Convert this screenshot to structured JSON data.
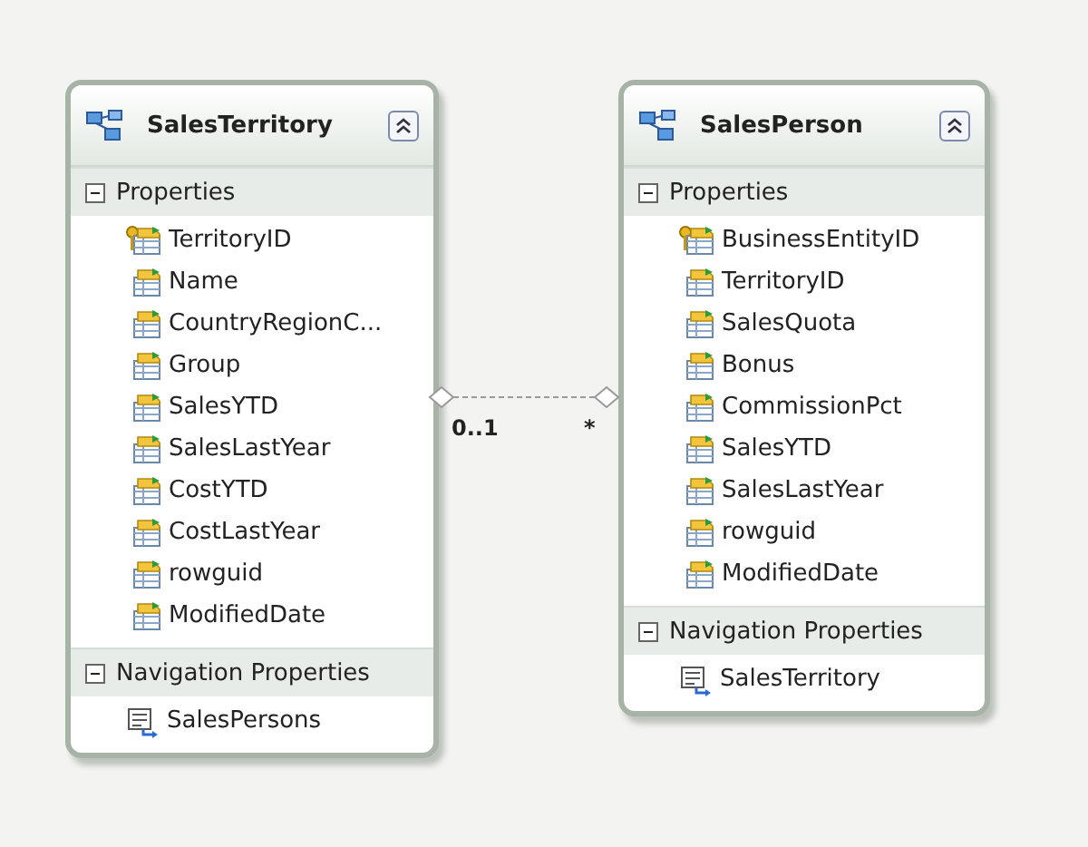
{
  "entities": [
    {
      "name": "SalesTerritory",
      "sections": [
        {
          "title": "Properties",
          "expanded": true,
          "items": [
            {
              "name": "TerritoryID",
              "kind": "key"
            },
            {
              "name": "Name",
              "kind": "scalar"
            },
            {
              "name": "CountryRegionC...",
              "kind": "scalar"
            },
            {
              "name": "Group",
              "kind": "scalar"
            },
            {
              "name": "SalesYTD",
              "kind": "scalar"
            },
            {
              "name": "SalesLastYear",
              "kind": "scalar"
            },
            {
              "name": "CostYTD",
              "kind": "scalar"
            },
            {
              "name": "CostLastYear",
              "kind": "scalar"
            },
            {
              "name": "rowguid",
              "kind": "scalar"
            },
            {
              "name": "ModifiedDate",
              "kind": "scalar"
            }
          ]
        },
        {
          "title": "Navigation Properties",
          "expanded": true,
          "items": [
            {
              "name": "SalesPersons",
              "kind": "navigation"
            }
          ]
        }
      ]
    },
    {
      "name": "SalesPerson",
      "sections": [
        {
          "title": "Properties",
          "expanded": true,
          "items": [
            {
              "name": "BusinessEntityID",
              "kind": "key"
            },
            {
              "name": "TerritoryID",
              "kind": "scalar"
            },
            {
              "name": "SalesQuota",
              "kind": "scalar"
            },
            {
              "name": "Bonus",
              "kind": "scalar"
            },
            {
              "name": "CommissionPct",
              "kind": "scalar"
            },
            {
              "name": "SalesYTD",
              "kind": "scalar"
            },
            {
              "name": "SalesLastYear",
              "kind": "scalar"
            },
            {
              "name": "rowguid",
              "kind": "scalar"
            },
            {
              "name": "ModifiedDate",
              "kind": "scalar"
            }
          ]
        },
        {
          "title": "Navigation Properties",
          "expanded": true,
          "items": [
            {
              "name": "SalesTerritory",
              "kind": "navigation"
            }
          ]
        }
      ]
    }
  ],
  "association": {
    "end_1": "0..1",
    "end_2": "*"
  }
}
